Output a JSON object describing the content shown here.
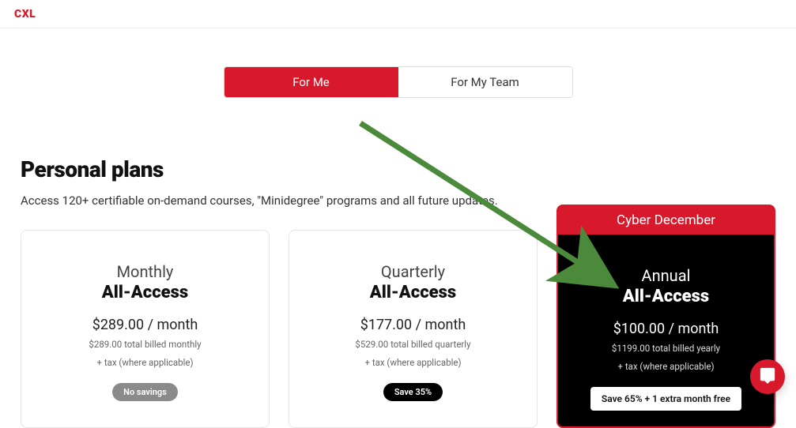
{
  "header": {
    "logo": "CXL"
  },
  "tabs": {
    "for_me": "For Me",
    "for_team": "For My Team"
  },
  "page": {
    "title": "Personal plans",
    "subtitle": "Access 120+ certifiable on-demand courses, \"Minidegree\" programs and all future updates."
  },
  "plans": {
    "monthly": {
      "name_top": "Monthly",
      "name_bold": "All-Access",
      "price": "$289.00 / month",
      "detail1": "$289.00 total billed monthly",
      "detail2": "+ tax (where applicable)",
      "badge": "No savings"
    },
    "quarterly": {
      "name_top": "Quarterly",
      "name_bold": "All-Access",
      "price": "$177.00 / month",
      "detail1": "$529.00 total billed quarterly",
      "detail2": "+ tax (where applicable)",
      "badge": "Save 35%"
    },
    "annual": {
      "promo": "Cyber December",
      "name_top": "Annual",
      "name_bold": "All-Access",
      "price": "$100.00 / month",
      "detail1": "$1199.00 total billed yearly",
      "detail2": "+ tax (where applicable)",
      "badge": "Save 65% + 1 extra month free"
    }
  }
}
